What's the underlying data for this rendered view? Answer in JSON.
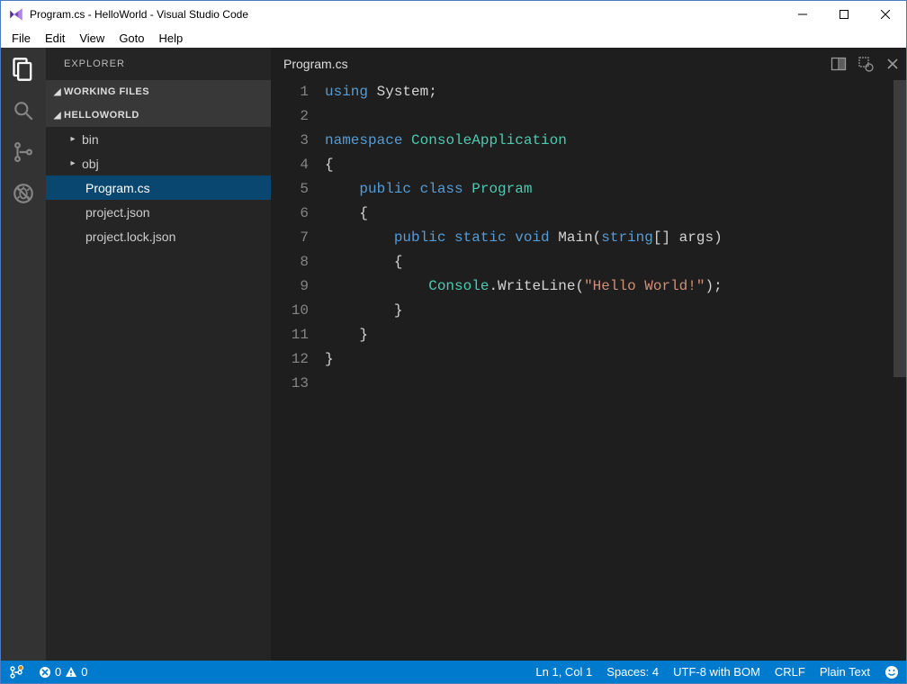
{
  "window": {
    "title": "Program.cs - HelloWorld - Visual Studio Code"
  },
  "menu": {
    "file": "File",
    "edit": "Edit",
    "view": "View",
    "goto": "Goto",
    "help": "Help"
  },
  "sidebar": {
    "title": "EXPLORER",
    "sections": {
      "working": "WORKING FILES",
      "project": "HELLOWORLD"
    },
    "tree": [
      {
        "label": "bin",
        "indent": 24,
        "chevron": "right",
        "selected": false
      },
      {
        "label": "obj",
        "indent": 24,
        "chevron": "right",
        "selected": false
      },
      {
        "label": "Program.cs",
        "indent": 44,
        "chevron": "",
        "selected": true
      },
      {
        "label": "project.json",
        "indent": 44,
        "chevron": "",
        "selected": false
      },
      {
        "label": "project.lock.json",
        "indent": 44,
        "chevron": "",
        "selected": false
      }
    ]
  },
  "editor": {
    "tab_title": "Program.cs",
    "code": [
      [
        {
          "c": "k",
          "t": "using"
        },
        {
          "c": "p",
          "t": " System;"
        }
      ],
      [],
      [
        {
          "c": "k",
          "t": "namespace"
        },
        {
          "c": "p",
          "t": " "
        },
        {
          "c": "cls",
          "t": "ConsoleApplication"
        }
      ],
      [
        {
          "c": "p",
          "t": "{"
        }
      ],
      [
        {
          "c": "p",
          "t": "    "
        },
        {
          "c": "k",
          "t": "public"
        },
        {
          "c": "p",
          "t": " "
        },
        {
          "c": "k",
          "t": "class"
        },
        {
          "c": "p",
          "t": " "
        },
        {
          "c": "cls",
          "t": "Program"
        }
      ],
      [
        {
          "c": "p",
          "t": "    {"
        }
      ],
      [
        {
          "c": "p",
          "t": "        "
        },
        {
          "c": "k",
          "t": "public"
        },
        {
          "c": "p",
          "t": " "
        },
        {
          "c": "k",
          "t": "static"
        },
        {
          "c": "p",
          "t": " "
        },
        {
          "c": "k",
          "t": "void"
        },
        {
          "c": "p",
          "t": " Main("
        },
        {
          "c": "k",
          "t": "string"
        },
        {
          "c": "p",
          "t": "[] args)"
        }
      ],
      [
        {
          "c": "p",
          "t": "        {"
        }
      ],
      [
        {
          "c": "p",
          "t": "            "
        },
        {
          "c": "cls",
          "t": "Console"
        },
        {
          "c": "p",
          "t": ".WriteLine("
        },
        {
          "c": "s",
          "t": "\"Hello World!\""
        },
        {
          "c": "p",
          "t": ");"
        }
      ],
      [
        {
          "c": "p",
          "t": "        }"
        }
      ],
      [
        {
          "c": "p",
          "t": "    }"
        }
      ],
      [
        {
          "c": "p",
          "t": "}"
        }
      ],
      []
    ]
  },
  "status": {
    "errors": "0",
    "warnings": "0",
    "position": "Ln 1, Col 1",
    "spaces": "Spaces: 4",
    "encoding": "UTF-8 with BOM",
    "eol": "CRLF",
    "language": "Plain Text"
  }
}
